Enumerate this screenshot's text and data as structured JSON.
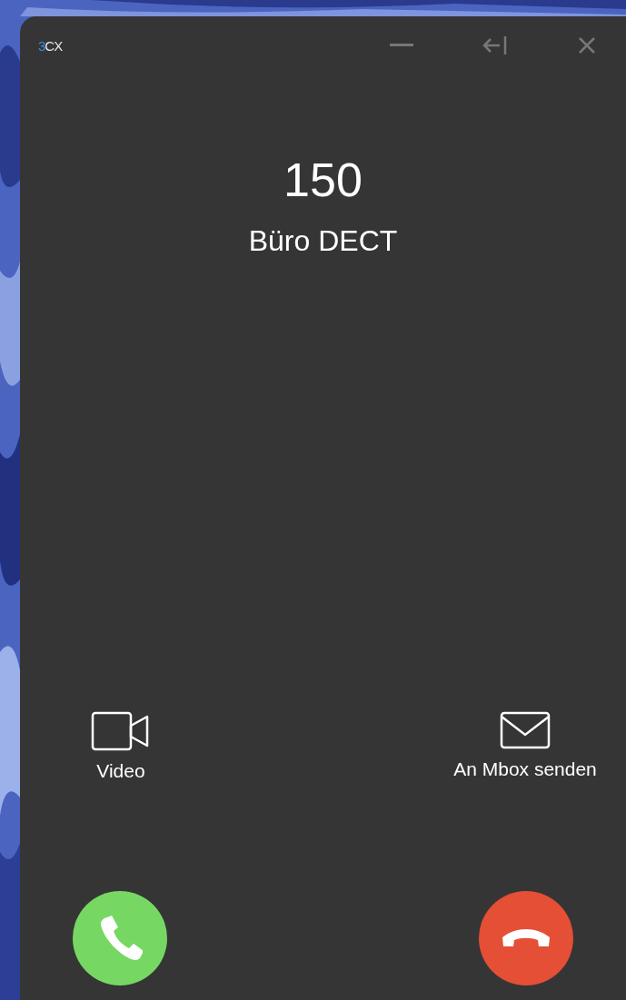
{
  "window": {
    "logo": {
      "accent": "3",
      "rest": "CX"
    },
    "controls": [
      {
        "kind": "minimize"
      },
      {
        "kind": "dock"
      },
      {
        "kind": "close"
      }
    ]
  },
  "caller": {
    "number": "150",
    "name": "Büro DECT"
  },
  "actions": [
    {
      "kind": "video",
      "label": "Video"
    },
    {
      "kind": "mail",
      "label": "An Mbox senden"
    }
  ],
  "call_buttons": [
    {
      "kind": "answer",
      "color": "#76d863"
    },
    {
      "kind": "decline",
      "color": "#e44f35"
    }
  ]
}
